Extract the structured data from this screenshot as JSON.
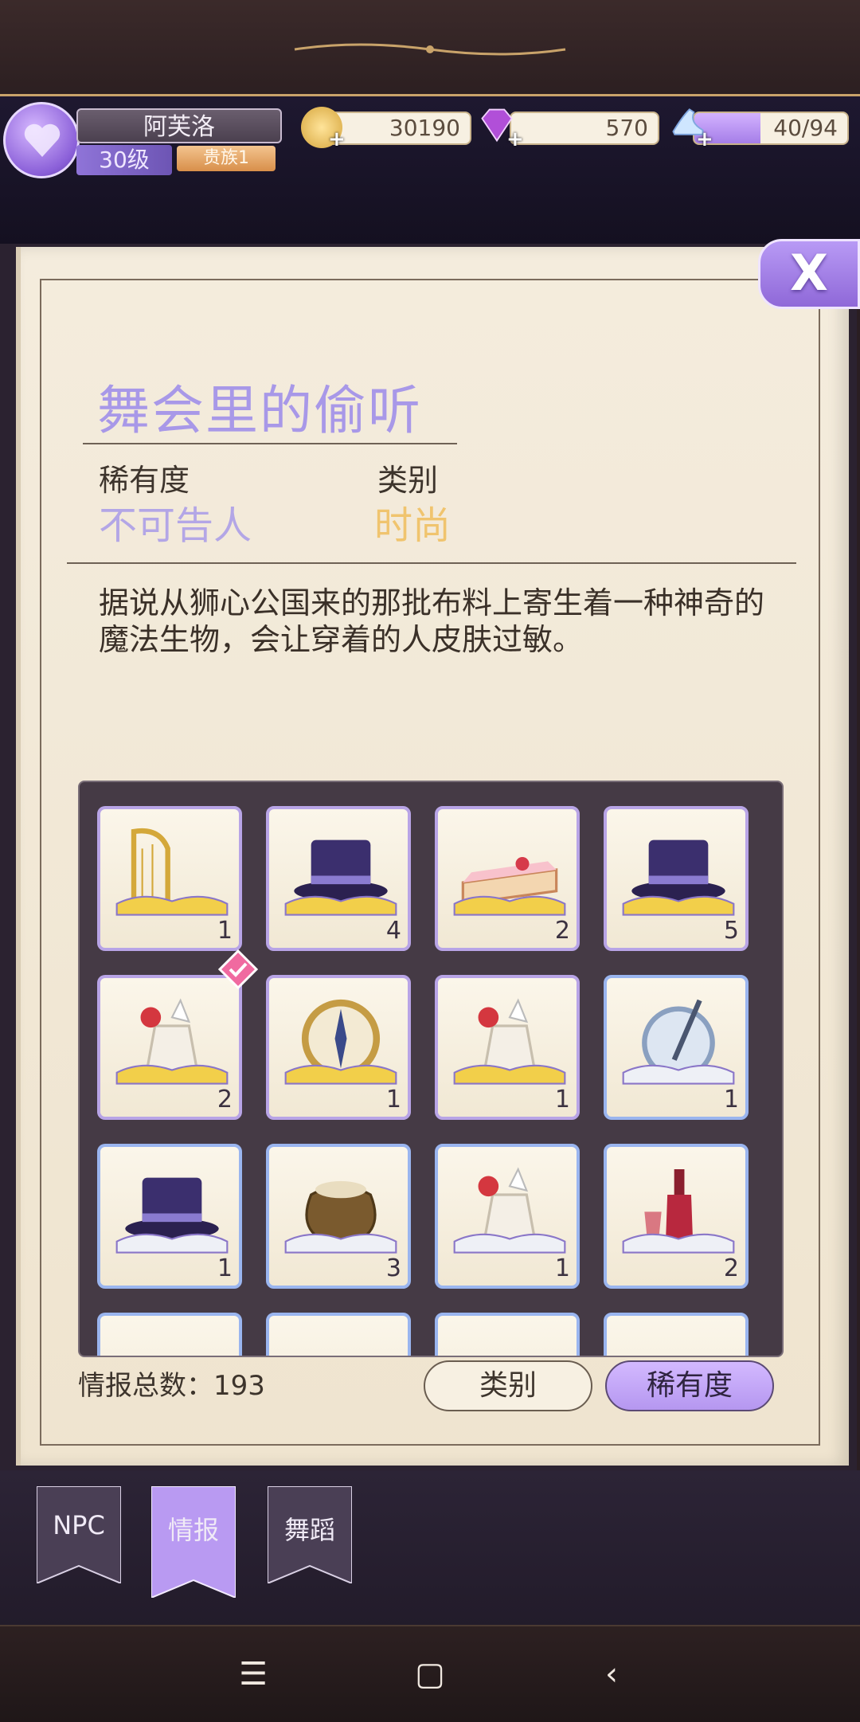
{
  "player": {
    "name": "阿芙洛",
    "level": "30级",
    "rank": "贵族1"
  },
  "resources": {
    "gold": "30190",
    "diamonds": "570",
    "stamina": "40/94",
    "stamina_fraction": 0.43
  },
  "close_label": "X",
  "card": {
    "title": "舞会里的偷听",
    "rarity_label": "稀有度",
    "rarity_value": "不可告人",
    "category_label": "类别",
    "category_value": "时尚",
    "description": "据说从狮心公国来的那批布料上寄生着一种神奇的魔法生物，会让穿着的人皮肤过敏。"
  },
  "items": [
    {
      "icon": "harp-icon",
      "count": "1",
      "border": "purple"
    },
    {
      "icon": "top-hat-icon",
      "count": "4",
      "border": "purple"
    },
    {
      "icon": "cake-icon",
      "count": "2",
      "border": "purple"
    },
    {
      "icon": "top-hat-icon",
      "count": "5",
      "border": "purple"
    },
    {
      "icon": "flower-vase-icon",
      "count": "2",
      "border": "purple",
      "selected": true
    },
    {
      "icon": "compass-icon",
      "count": "1",
      "border": "purple"
    },
    {
      "icon": "flower-vase-icon",
      "count": "1",
      "border": "purple"
    },
    {
      "icon": "shield-sword-icon",
      "count": "1",
      "border": "blue"
    },
    {
      "icon": "top-hat-icon",
      "count": "1",
      "border": "blue"
    },
    {
      "icon": "sack-icon",
      "count": "3",
      "border": "blue"
    },
    {
      "icon": "flower-vase-icon",
      "count": "1",
      "border": "blue"
    },
    {
      "icon": "wine-bottle-icon",
      "count": "2",
      "border": "blue"
    }
  ],
  "footer": {
    "total": "情报总数：193",
    "sort_category": "类别",
    "sort_rarity": "稀有度"
  },
  "tabs": [
    {
      "label": "NPC"
    },
    {
      "label": "情报"
    },
    {
      "label": "舞蹈"
    }
  ],
  "colors": {
    "accent": "#b89af5",
    "title": "#a898e8",
    "category": "#f0c46e"
  }
}
